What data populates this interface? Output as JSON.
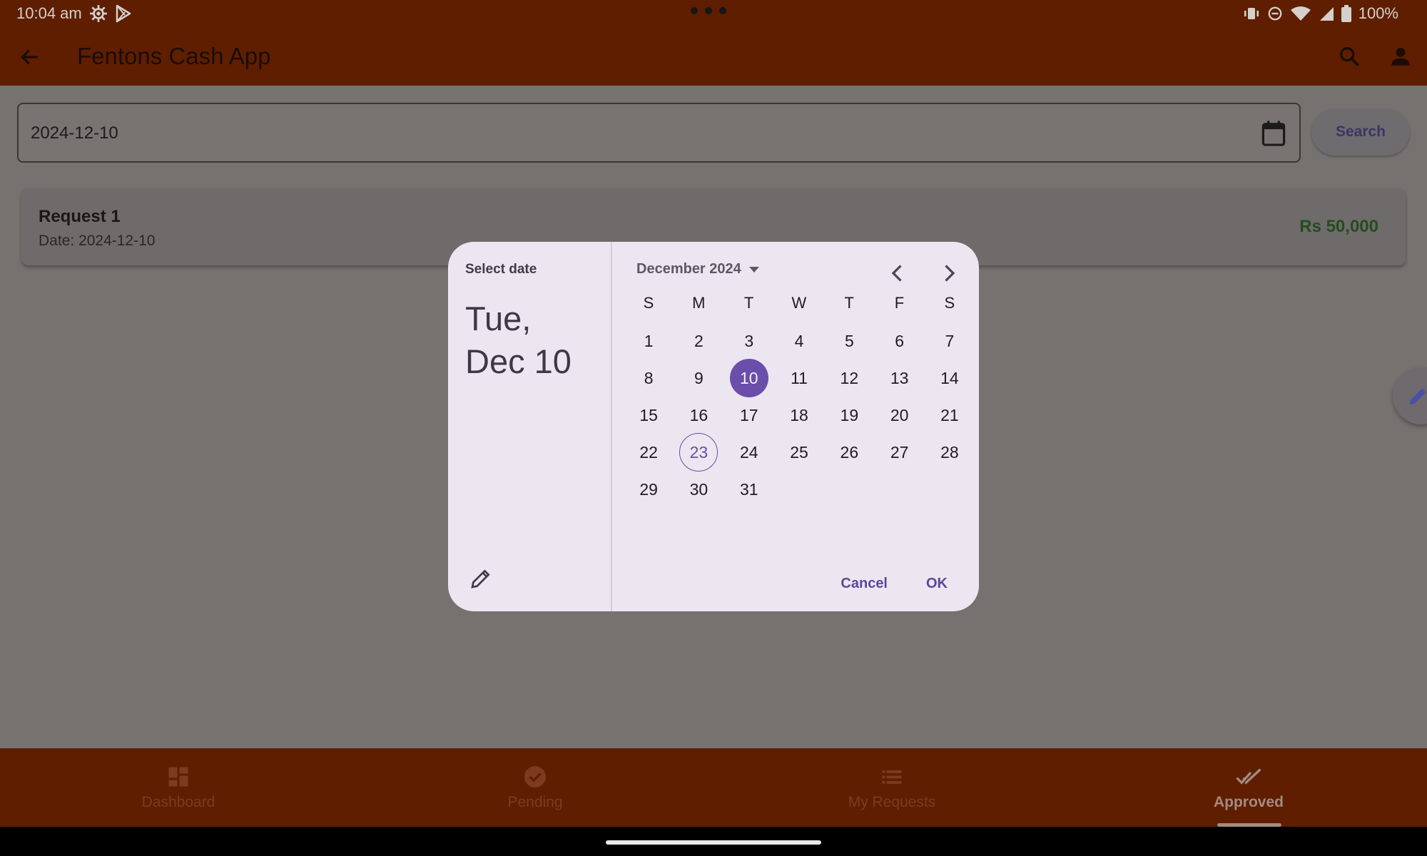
{
  "statusbar": {
    "time": "10:04 am",
    "battery": "100%"
  },
  "appbar": {
    "title": "Fentons Cash App"
  },
  "filter": {
    "date_value": "2024-12-10",
    "search_label": "Search"
  },
  "request": {
    "title": "Request 1",
    "date": "Date: 2024-12-10",
    "amount": "Rs 50,000"
  },
  "dialog": {
    "label": "Select date",
    "headline_line1": "Tue,",
    "headline_line2": "Dec 10",
    "month_label": "December 2024",
    "weekdays": [
      "S",
      "M",
      "T",
      "W",
      "T",
      "F",
      "S"
    ],
    "selected_day": 10,
    "today_day": 23,
    "first_weekday_index": 0,
    "days_in_month": 31,
    "cancel_label": "Cancel",
    "ok_label": "OK"
  },
  "nav": {
    "items": [
      {
        "label": "Dashboard",
        "icon": "dashboard-icon"
      },
      {
        "label": "Pending",
        "icon": "check-circle-icon"
      },
      {
        "label": "My Requests",
        "icon": "list-icon"
      },
      {
        "label": "Approved",
        "icon": "done-all-icon"
      }
    ],
    "active_index": 3
  },
  "colors": {
    "appbar": "#5f1e00",
    "accent": "#6a4ea9",
    "amount": "#244d21"
  }
}
